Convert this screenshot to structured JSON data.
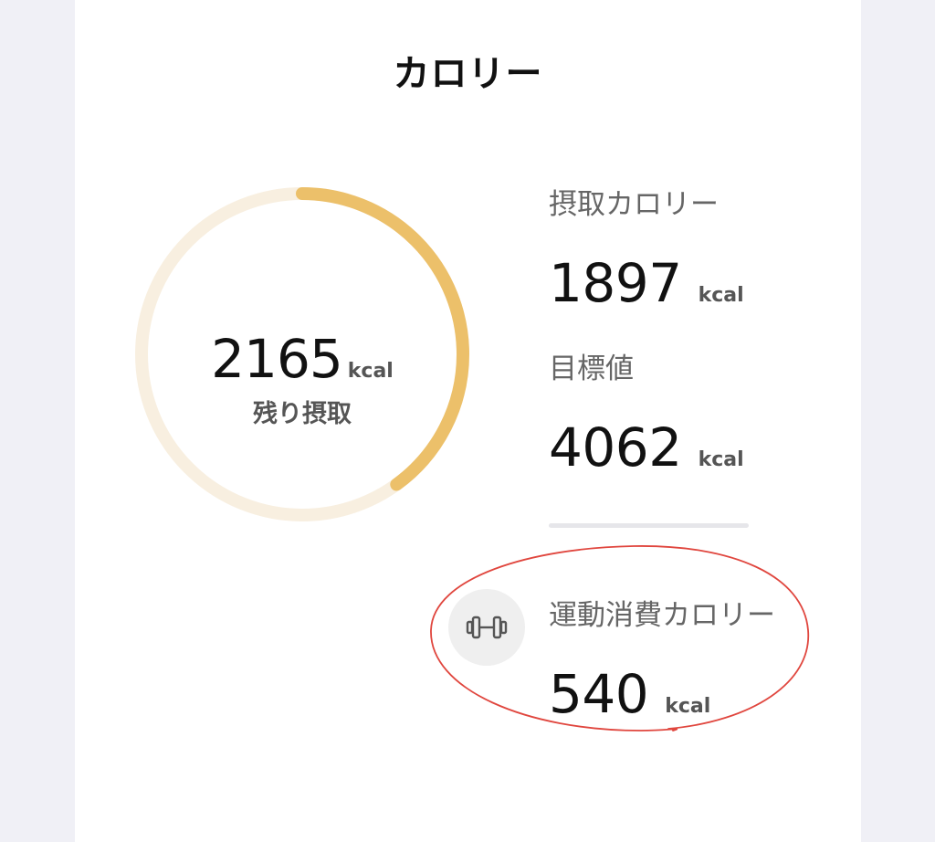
{
  "header": {
    "title": "カロリー"
  },
  "ring": {
    "value": "2165",
    "unit": "kcal",
    "label": "残り摂取",
    "progress_fraction": 0.4,
    "progress_color": "#ecc06a",
    "track_color": "#f8efe0"
  },
  "intake": {
    "label": "摂取カロリー",
    "value": "1897",
    "unit": "kcal"
  },
  "goal": {
    "label": "目標値",
    "value": "4062",
    "unit": "kcal"
  },
  "exercise": {
    "icon": "dumbbell-icon",
    "label": "運動消費カロリー",
    "value": "540",
    "unit": "kcal",
    "annotation_color": "#e0463e"
  }
}
